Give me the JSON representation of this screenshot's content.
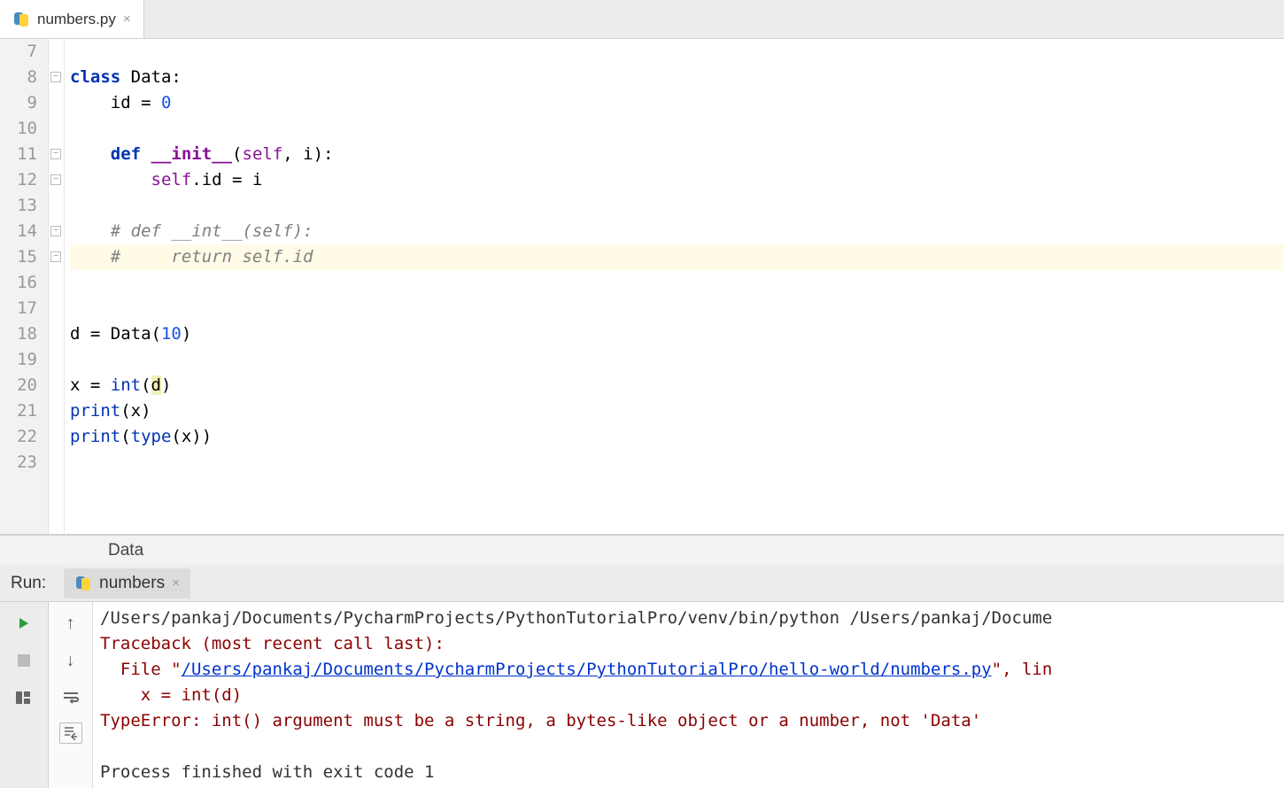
{
  "tab": {
    "filename": "numbers.py"
  },
  "editor": {
    "line_start": 7,
    "line_end": 23,
    "highlighted_line": 15,
    "lines": {
      "7": "",
      "8": {
        "prefix": "class ",
        "name": "Data",
        "suffix": ":"
      },
      "9": {
        "indent": "    ",
        "text": "id = ",
        "num": "0"
      },
      "10": "",
      "11": {
        "indent": "    ",
        "kw": "def ",
        "fn": "__init__",
        "params": "(self, i):"
      },
      "12": {
        "indent": "        ",
        "self": "self",
        "rest": ".id = i"
      },
      "13": "",
      "14": {
        "indent": "    ",
        "comment": "# def __int__(self):"
      },
      "15": {
        "indent": "    ",
        "comment": "#     return self.id"
      },
      "16": "",
      "17": "",
      "18": {
        "text1": "d = Data(",
        "num": "10",
        "text2": ")"
      },
      "19": "",
      "20": {
        "text1": "x = ",
        "builtin": "int",
        "text2": "(",
        "hl": "d",
        "text3": ")"
      },
      "21": {
        "builtin": "print",
        "text": "(x)"
      },
      "22": {
        "builtin": "print",
        "text1": "(",
        "builtin2": "type",
        "text2": "(x))"
      },
      "23": ""
    }
  },
  "breadcrumb": {
    "path": "Data"
  },
  "run": {
    "label": "Run:",
    "tab_name": "numbers",
    "output": {
      "cmd": "/Users/pankaj/Documents/PycharmProjects/PythonTutorialPro/venv/bin/python /Users/pankaj/Docume",
      "trace1": "Traceback (most recent call last):",
      "trace2_pre": "  File \"",
      "trace2_link": "/Users/pankaj/Documents/PycharmProjects/PythonTutorialPro/hello-world/numbers.py",
      "trace2_post": "\", lin",
      "trace3": "    x = int(d)",
      "trace4": "TypeError: int() argument must be a string, a bytes-like object or a number, not 'Data'",
      "exit": "Process finished with exit code 1"
    }
  }
}
